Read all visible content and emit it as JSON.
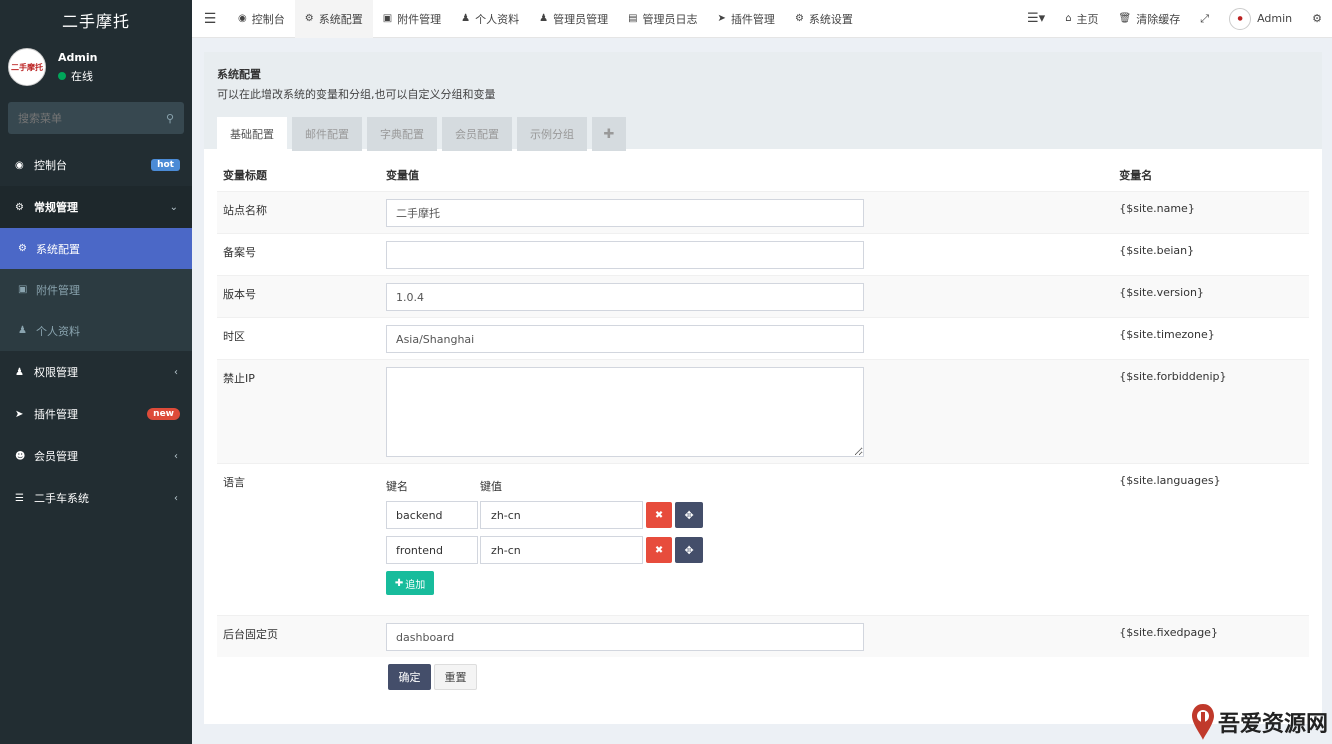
{
  "sidebar": {
    "logo": "二手摩托",
    "user": {
      "name": "Admin",
      "status": "在线",
      "avatar_text": "二手摩托"
    },
    "search_placeholder": "搜索菜单",
    "items": [
      {
        "label": "控制台",
        "icon": "dashboard-icon",
        "badge": "hot"
      },
      {
        "label": "常规管理",
        "icon": "cogs-icon"
      },
      {
        "label": "权限管理",
        "icon": "users-icon"
      },
      {
        "label": "插件管理",
        "icon": "rocket-icon",
        "badge": "new"
      },
      {
        "label": "会员管理",
        "icon": "user-circle-icon"
      },
      {
        "label": "二手车系统",
        "icon": "list-icon"
      }
    ],
    "subitems": [
      {
        "label": "系统配置",
        "icon": "cog-icon"
      },
      {
        "label": "附件管理",
        "icon": "image-icon"
      },
      {
        "label": "个人资料",
        "icon": "user-icon"
      }
    ]
  },
  "topbar": {
    "tabs": [
      {
        "label": "控制台",
        "icon": "dashboard-icon"
      },
      {
        "label": "系统配置",
        "icon": "cog-icon"
      },
      {
        "label": "附件管理",
        "icon": "image-icon"
      },
      {
        "label": "个人资料",
        "icon": "user-icon"
      },
      {
        "label": "管理员管理",
        "icon": "user-icon"
      },
      {
        "label": "管理员日志",
        "icon": "list-alt-icon"
      },
      {
        "label": "插件管理",
        "icon": "rocket-icon"
      },
      {
        "label": "系统设置",
        "icon": "cogs-icon"
      }
    ],
    "home": "主页",
    "clear_cache": "清除缓存",
    "admin": "Admin"
  },
  "panel": {
    "title": "系统配置",
    "desc": "可以在此增改系统的变量和分组,也可以自定义分组和变量",
    "tabs": [
      "基础配置",
      "邮件配置",
      "字典配置",
      "会员配置",
      "示例分组"
    ]
  },
  "table": {
    "headers": [
      "变量标题",
      "变量值",
      "变量名"
    ],
    "rows": [
      {
        "title": "站点名称",
        "value": "二手摩托",
        "var": "{$site.name}"
      },
      {
        "title": "备案号",
        "value": "",
        "var": "{$site.beian}"
      },
      {
        "title": "版本号",
        "value": "1.0.4",
        "var": "{$site.version}"
      },
      {
        "title": "时区",
        "value": "Asia/Shanghai",
        "var": "{$site.timezone}"
      },
      {
        "title": "禁止IP",
        "value": "",
        "var": "{$site.forbiddenip}"
      },
      {
        "title": "语言",
        "var": "{$site.languages}"
      },
      {
        "title": "后台固定页",
        "value": "dashboard",
        "var": "{$site.fixedpage}"
      }
    ],
    "languages": {
      "key_header": "键名",
      "value_header": "键值",
      "items": [
        {
          "key": "backend",
          "value": "zh-cn"
        },
        {
          "key": "frontend",
          "value": "zh-cn"
        }
      ],
      "add_label": "追加"
    },
    "submit_label": "确定",
    "reset_label": "重置"
  },
  "watermark": "吾爱资源网",
  "colors": {
    "sidebar": "#222d32",
    "active": "#4b68c7",
    "primary": "#444e6a",
    "danger": "#e74c3c",
    "success": "#18bc9c"
  }
}
